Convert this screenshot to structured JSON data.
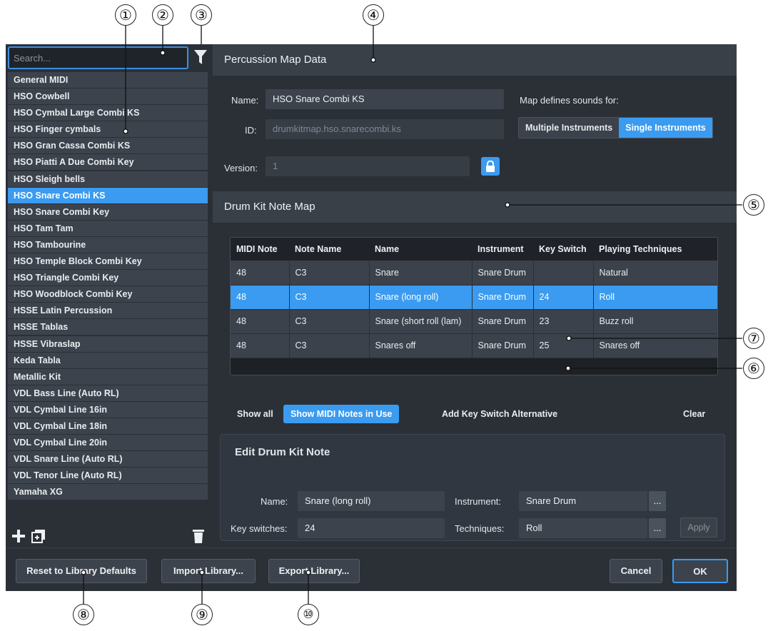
{
  "callouts": [
    "①",
    "②",
    "③",
    "④",
    "⑤",
    "⑥",
    "⑦",
    "⑧",
    "⑨",
    "⑩"
  ],
  "left": {
    "search_placeholder": "Search...",
    "items": [
      "General MIDI",
      "HSO Cowbell",
      "HSO Cymbal Large Combi KS",
      "HSO Finger cymbals",
      "HSO Gran Cassa Combi KS",
      "HSO Piatti A Due Combi Key",
      "HSO Sleigh bells",
      "HSO Snare Combi KS",
      "HSO Snare Combi Key",
      "HSO Tam Tam",
      "HSO Tambourine",
      "HSO Temple Block Combi Key",
      "HSO Triangle Combi Key",
      "HSO Woodblock Combi Key",
      "HSSE Latin Percussion",
      "HSSE Tablas",
      "HSSE Vibraslap",
      "Keda Tabla",
      "Metallic Kit",
      "VDL Bass Line (Auto RL)",
      "VDL Cymbal Line 16in",
      "VDL Cymbal Line 18in",
      "VDL Cymbal Line 20in",
      "VDL Snare Line (Auto RL)",
      "VDL Tenor Line (Auto RL)",
      "Yamaha XG"
    ],
    "selected_index": 7
  },
  "map_data": {
    "title": "Percussion Map Data",
    "name_label": "Name:",
    "name_value": "HSO Snare Combi KS",
    "id_label": "ID:",
    "id_value": "drumkitmap.hso.snarecombi.ks",
    "version_label": "Version:",
    "version_value": "1",
    "defines_label": "Map defines sounds for:",
    "multiple_label": "Multiple Instruments",
    "single_label": "Single Instruments"
  },
  "note_map": {
    "title": "Drum Kit Note Map",
    "columns": [
      "MIDI Note",
      "Note Name",
      "Name",
      "Instrument",
      "Key Switch",
      "Playing Techniques"
    ],
    "rows": [
      [
        "48",
        "C3",
        "Snare",
        "Snare Drum",
        "",
        "Natural"
      ],
      [
        "48",
        "C3",
        "Snare (long roll)",
        "Snare Drum",
        "24",
        "Roll"
      ],
      [
        "48",
        "C3",
        "Snare (short roll (lam)",
        "Snare Drum",
        "23",
        "Buzz roll"
      ],
      [
        "48",
        "C3",
        "Snares off",
        "Snare Drum",
        "25",
        "Snares off"
      ]
    ],
    "selected_row": 1,
    "show_all": "Show all",
    "show_in_use": "Show MIDI Notes in Use",
    "add_key_switch": "Add Key Switch Alternative",
    "clear": "Clear"
  },
  "edit": {
    "title": "Edit Drum Kit Note",
    "name_label": "Name:",
    "name_value": "Snare (long roll)",
    "instrument_label": "Instrument:",
    "instrument_value": "Snare Drum",
    "keyswitch_label": "Key switches:",
    "keyswitch_value": "24",
    "techniques_label": "Techniques:",
    "techniques_value": "Roll",
    "dots": "...",
    "apply": "Apply"
  },
  "footer": {
    "reset": "Reset to Library Defaults",
    "import": "Import Library...",
    "export": "Export Library...",
    "cancel": "Cancel",
    "ok": "OK"
  },
  "colors": {
    "accent": "#3a9bf0",
    "panel": "#2b3037",
    "row": "#3b424b"
  }
}
